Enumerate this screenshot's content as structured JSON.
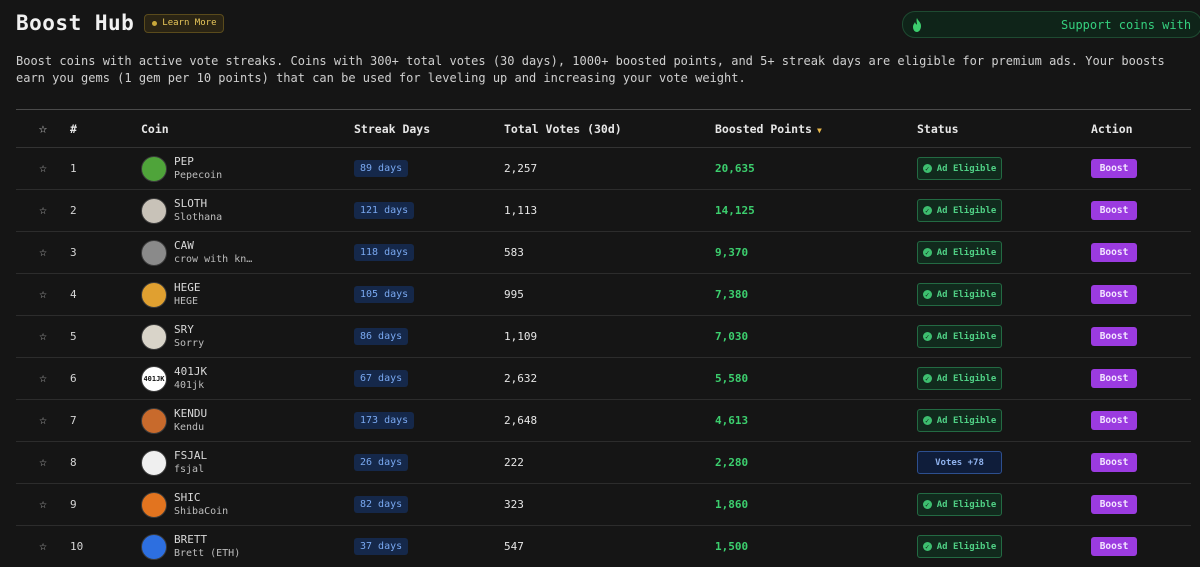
{
  "header": {
    "title": "Boost Hub",
    "learn_more": "Learn More",
    "support_label": "Support coins with"
  },
  "description": "Boost coins with active vote streaks. Coins with 300+ total votes (30 days), 1000+ boosted points, and 5+ streak days are eligible for premium ads. Your boosts earn you gems (1 gem per 10 points) that can be used for leveling up and increasing your vote weight.",
  "table": {
    "columns": {
      "star": "☆",
      "rank": "#",
      "coin": "Coin",
      "streak": "Streak Days",
      "votes": "Total Votes (30d)",
      "boosted": "Boosted Points",
      "status": "Status",
      "action": "Action"
    },
    "sort_indicator": "▼",
    "rows": [
      {
        "rank": "1",
        "symbol": "PEP",
        "name": "Pepecoin",
        "streak": "89 days",
        "votes": "2,257",
        "points": "20,635",
        "status": "Ad Eligible",
        "status_type": "eligible",
        "action": "Boost",
        "avatar_color": "#4fa43a",
        "avatar_text": ""
      },
      {
        "rank": "2",
        "symbol": "SLOTH",
        "name": "Slothana",
        "streak": "121 days",
        "votes": "1,113",
        "points": "14,125",
        "status": "Ad Eligible",
        "status_type": "eligible",
        "action": "Boost",
        "avatar_color": "#c8c2b8",
        "avatar_text": ""
      },
      {
        "rank": "3",
        "symbol": "CAW",
        "name": "crow with kn…",
        "streak": "118 days",
        "votes": "583",
        "points": "9,370",
        "status": "Ad Eligible",
        "status_type": "eligible",
        "action": "Boost",
        "avatar_color": "#8a8a8a",
        "avatar_text": ""
      },
      {
        "rank": "4",
        "symbol": "HEGE",
        "name": "HEGE",
        "streak": "105 days",
        "votes": "995",
        "points": "7,380",
        "status": "Ad Eligible",
        "status_type": "eligible",
        "action": "Boost",
        "avatar_color": "#e0a030",
        "avatar_text": ""
      },
      {
        "rank": "5",
        "symbol": "SRY",
        "name": "Sorry",
        "streak": "86 days",
        "votes": "1,109",
        "points": "7,030",
        "status": "Ad Eligible",
        "status_type": "eligible",
        "action": "Boost",
        "avatar_color": "#d9d4c9",
        "avatar_text": ""
      },
      {
        "rank": "6",
        "symbol": "401JK",
        "name": "401jk",
        "streak": "67 days",
        "votes": "2,632",
        "points": "5,580",
        "status": "Ad Eligible",
        "status_type": "eligible",
        "action": "Boost",
        "avatar_color": "#ffffff",
        "avatar_text": "401JK"
      },
      {
        "rank": "7",
        "symbol": "KENDU",
        "name": "Kendu",
        "streak": "173 days",
        "votes": "2,648",
        "points": "4,613",
        "status": "Ad Eligible",
        "status_type": "eligible",
        "action": "Boost",
        "avatar_color": "#c86a2c",
        "avatar_text": ""
      },
      {
        "rank": "8",
        "symbol": "FSJAL",
        "name": "fsjal",
        "streak": "26 days",
        "votes": "222",
        "points": "2,280",
        "status": "Votes +78",
        "status_type": "votes",
        "action": "Boost",
        "avatar_color": "#efefef",
        "avatar_text": ""
      },
      {
        "rank": "9",
        "symbol": "SHIC",
        "name": "ShibaCoin",
        "streak": "82 days",
        "votes": "323",
        "points": "1,860",
        "status": "Ad Eligible",
        "status_type": "eligible",
        "action": "Boost",
        "avatar_color": "#e2741f",
        "avatar_text": ""
      },
      {
        "rank": "10",
        "symbol": "BRETT",
        "name": "Brett (ETH)",
        "streak": "37 days",
        "votes": "547",
        "points": "1,500",
        "status": "Ad Eligible",
        "status_type": "eligible",
        "action": "Boost",
        "avatar_color": "#2d6fe0",
        "avatar_text": ""
      }
    ]
  },
  "icons": {
    "learn_more": "dot-icon",
    "support": "flame-icon",
    "favorite": "star-icon",
    "status_ok": "check-icon"
  },
  "colors": {
    "accent_green": "#3ccf6e",
    "boost_purple": "#9b3be0",
    "streak_blue": "#79a8f0",
    "gold": "#e8c75a"
  }
}
